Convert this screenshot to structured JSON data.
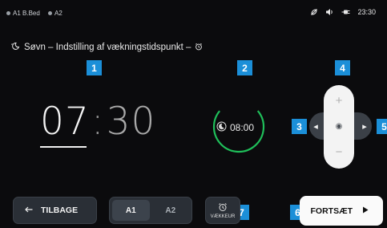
{
  "status_bar": {
    "zones": [
      {
        "label": "A1 B.Bed",
        "color": "#9aa0a6"
      },
      {
        "label": "A2",
        "color": "#9aa0a6"
      }
    ],
    "icons": [
      "leaf-off-icon",
      "volume-icon",
      "plug-icon"
    ],
    "time": "23:30"
  },
  "header": {
    "icon": "sleep-icon",
    "title": "Søvn – Indstilling af vækningstidspunkt –",
    "trailing_icon": "alarm-icon"
  },
  "markers": [
    "1",
    "2",
    "3",
    "4",
    "5",
    "6",
    "7"
  ],
  "wake_time": {
    "hours": "07",
    "separator": ":",
    "minutes": "30"
  },
  "duration": {
    "value": "08:00",
    "icon": "moon-icon",
    "progress": 0.72
  },
  "control_pad": {
    "up": "+",
    "down": "−",
    "left": "◂",
    "right": "▸",
    "center": "◉"
  },
  "footer": {
    "back_label": "TILBAGE",
    "segments": [
      {
        "label": "A1",
        "active": true
      },
      {
        "label": "A2",
        "active": false
      }
    ],
    "alarm_label": "VÆKKEUR",
    "continue_label": "FORTSÆT"
  },
  "colors": {
    "accent": "#1b8fd8",
    "ring": "#1fbf5a",
    "button_bg": "#2a2f36"
  }
}
